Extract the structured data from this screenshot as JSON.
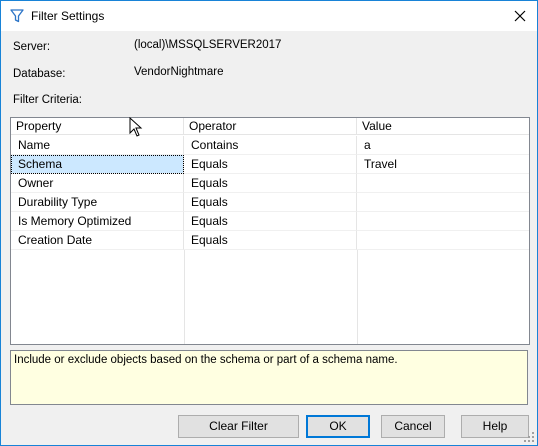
{
  "window": {
    "title": "Filter Settings"
  },
  "info": {
    "server_label": "Server:",
    "server_value": "(local)\\MSSQLSERVER2017",
    "database_label": "Database:",
    "database_value": "VendorNightmare",
    "criteria_label": "Filter Criteria:"
  },
  "grid": {
    "columns": [
      "Property",
      "Operator",
      "Value"
    ],
    "rows": [
      {
        "property": "Name",
        "operator": "Contains",
        "value": "a"
      },
      {
        "property": "Schema",
        "operator": "Equals",
        "value": "Travel"
      },
      {
        "property": "Owner",
        "operator": "Equals",
        "value": ""
      },
      {
        "property": "Durability Type",
        "operator": "Equals",
        "value": ""
      },
      {
        "property": "Is Memory Optimized",
        "operator": "Equals",
        "value": ""
      },
      {
        "property": "Creation Date",
        "operator": "Equals",
        "value": ""
      }
    ],
    "selected_row": 1
  },
  "description": "Include or exclude objects based on the schema or part of a schema name.",
  "buttons": {
    "clear_filter": "Clear Filter",
    "ok": "OK",
    "cancel": "Cancel",
    "help": "Help"
  },
  "icons": {
    "title": "filter-funnel-icon",
    "close": "close-icon"
  },
  "colors": {
    "border_accent": "#1883d7",
    "selected_row": "#cce8ff",
    "description_bg": "#ffffe1",
    "default_button_border": "#0078d7"
  }
}
